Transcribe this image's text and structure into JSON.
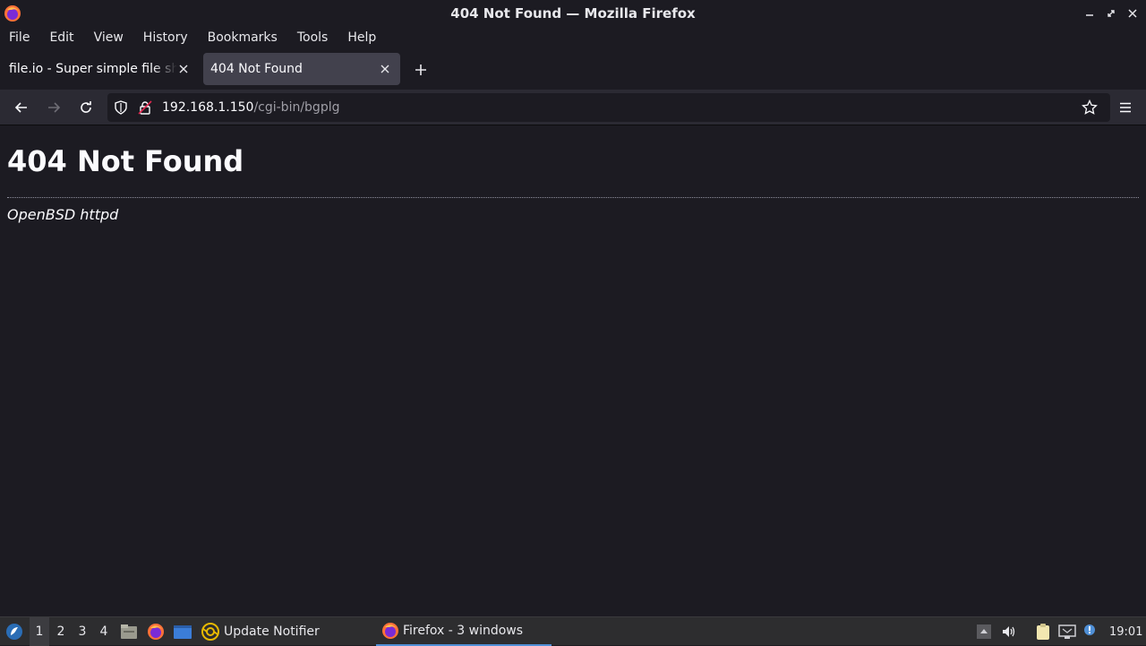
{
  "window": {
    "title": "404 Not Found — Mozilla Firefox"
  },
  "menubar": {
    "items": [
      "File",
      "Edit",
      "View",
      "History",
      "Bookmarks",
      "Tools",
      "Help"
    ]
  },
  "tabs": [
    {
      "label": "file.io - Super simple file sharing",
      "active": false
    },
    {
      "label": "404 Not Found",
      "active": true
    }
  ],
  "urlbar": {
    "host": "192.168.1.150",
    "path": "/cgi-bin/bgplg"
  },
  "page": {
    "heading": "404 Not Found",
    "footer": "OpenBSD httpd"
  },
  "taskbar": {
    "workspaces": [
      "1",
      "2",
      "3",
      "4"
    ],
    "current_workspace": "1",
    "update_notifier": "Update Notifier",
    "firefox_task": "Firefox - 3 windows",
    "clock": "19:01"
  },
  "colors": {
    "background": "#1c1b22",
    "toolbar": "#2b2a33",
    "active_tab": "#42414d",
    "taskbar": "#2d2d2f",
    "accent": "#4f8fd6"
  },
  "icons": {
    "app": "firefox-icon",
    "back": "back-arrow-icon",
    "forward": "forward-arrow-icon",
    "reload": "reload-icon",
    "shield": "tracking-protection-shield-icon",
    "lock": "insecure-lock-icon",
    "star": "bookmark-star-icon",
    "menu": "hamburger-menu-icon"
  }
}
